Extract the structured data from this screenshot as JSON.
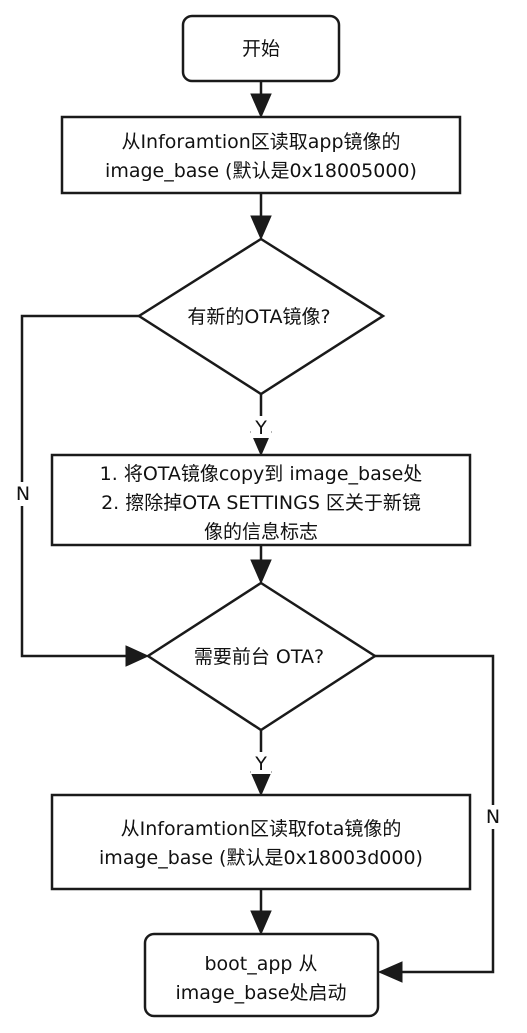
{
  "nodes": {
    "start": {
      "label": "开始"
    },
    "read_app_image": {
      "lines": [
        "从Inforamtion区读取app镜像的",
        "image_base (默认是0x18005000)"
      ]
    },
    "has_new_ota": {
      "label": "有新的OTA镜像?"
    },
    "copy_ota": {
      "lines": [
        "1. 将OTA镜像copy到 image_base处",
        "2. 擦除掉OTA SETTINGS 区关于新镜",
        "像的信息标志"
      ]
    },
    "need_foreground_ota": {
      "label": "需要前台 OTA?"
    },
    "read_fota_image": {
      "lines": [
        "从Inforamtion区读取fota镜像的",
        "image_base (默认是0x18003d000)"
      ]
    },
    "boot_app": {
      "lines": [
        "boot_app 从",
        "image_base处启动"
      ]
    }
  },
  "edges": {
    "yes_label_1": "Y",
    "no_label_1": "N",
    "yes_label_2": "Y",
    "no_label_2": "N"
  }
}
